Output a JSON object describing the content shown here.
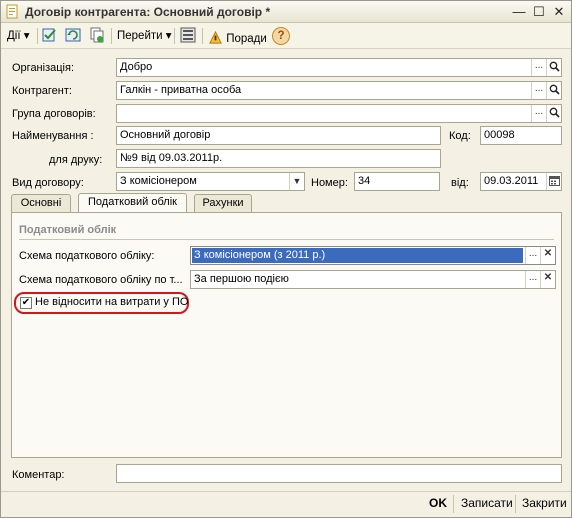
{
  "window": {
    "title": "Договір контрагента: Основний договір *",
    "min_glyph": "—",
    "max_glyph": "☐",
    "close_glyph": "✕"
  },
  "toolbar": {
    "actions_label": "Дії",
    "goto_label": "Перейти",
    "tips_label": "Поради",
    "dropdown_glyph": "▾",
    "help_glyph": "?"
  },
  "form": {
    "organization_label": "Організація:",
    "organization_value": "Добро",
    "counterparty_label": "Контрагент:",
    "counterparty_value": "Галкін - приватна особа",
    "group_label": "Група договорів:",
    "group_value": "",
    "name_label": "Найменування :",
    "name_value": "Основний договір",
    "code_label": "Код:",
    "code_value": "00098",
    "print_label": "для друку:",
    "print_value": "№9 від 09.03.2011р.",
    "type_label": "Вид договору:",
    "type_value": "З комісіонером",
    "number_label": "Номер:",
    "number_value": "34",
    "date_label": "від:",
    "date_value": "09.03.2011",
    "ellipsis_glyph": "...",
    "search_glyph": "🔍",
    "clear_glyph": "✕",
    "combo_glyph": "▼"
  },
  "tabs": [
    {
      "label": "Основні"
    },
    {
      "label": "Податковий облік"
    },
    {
      "label": "Рахунки"
    }
  ],
  "tax": {
    "section_title": "Податковий облік",
    "scheme_label": "Схема податкового обліку:",
    "scheme_value": "З комісіонером (з 2011 р.)",
    "scheme_by_label": "Схема податкового обліку по т...",
    "scheme_by_value": "За першою подією",
    "expense_checkbox_label": "Не відносити на витрати у ПО",
    "expense_checkbox_checked": true,
    "check_glyph": "✔"
  },
  "comment": {
    "label": "Коментар:",
    "value": ""
  },
  "footer": {
    "ok_label": "OK",
    "save_label": "Записати",
    "close_label": "Закрити"
  }
}
